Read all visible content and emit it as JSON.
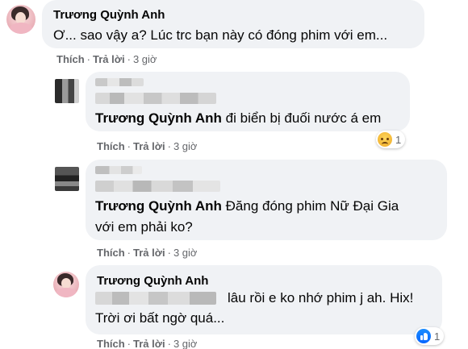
{
  "colors": {
    "bubble_bg": "#f0f2f5",
    "meta_text": "#65676b",
    "text": "#050505",
    "like_blue": "#0866ff",
    "sad_yellow": "#f4b736"
  },
  "comments": [
    {
      "author": "Trương Quỳnh Anh",
      "text": "Ơ... sao vậy a? Lúc trc bạn này có đóng phim với em...",
      "like_label": "Thích",
      "reply_label": "Trả lời",
      "separator": "·",
      "time": "3 giờ",
      "avatar_icon": "profile-photo"
    },
    {
      "mention": "Trương Quỳnh Anh",
      "text": "đi biển bị đuối nước á em",
      "like_label": "Thích",
      "reply_label": "Trả lời",
      "separator": "·",
      "time": "3 giờ",
      "reaction": {
        "icon": "sad-reaction-icon",
        "count": "1"
      }
    },
    {
      "mention": "Trương Quỳnh Anh",
      "text_line1": "Đăng đóng phim Nữ Đại Gia",
      "text_line2": "với em phải ko?",
      "like_label": "Thích",
      "reply_label": "Trả lời",
      "separator": "·",
      "time": "3 giờ"
    },
    {
      "author": "Trương Quỳnh Anh",
      "text_line1": "lâu rồi e ko nhớ phim j ah. Hix!",
      "text_line2": "Trời ơi bất ngờ quá...",
      "like_label": "Thích",
      "reply_label": "Trả lời",
      "separator": "·",
      "time": "3 giờ",
      "reaction": {
        "icon": "like-reaction-icon",
        "count": "1"
      }
    }
  ]
}
